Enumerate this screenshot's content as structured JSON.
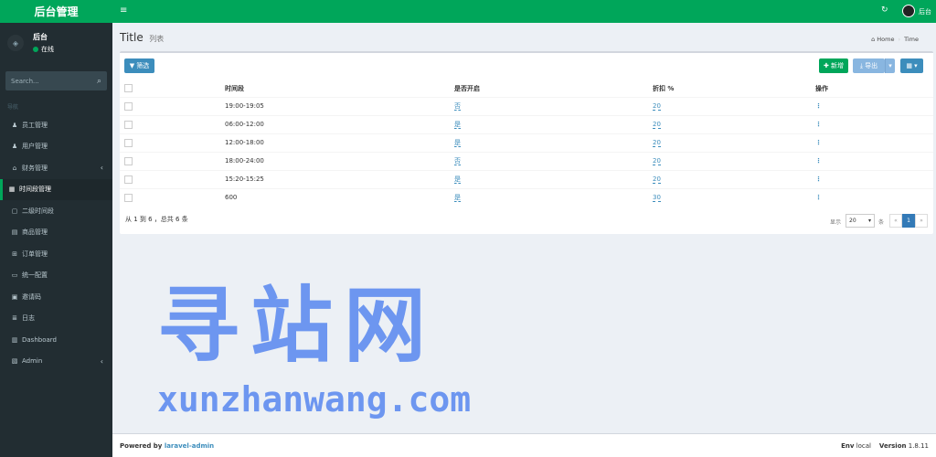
{
  "sidebar": {
    "logo": "后台管理",
    "user_name": "后台",
    "user_status": "在线",
    "search_placeholder": "Search...",
    "menu_header": "导航",
    "items": [
      {
        "label": "员工管理",
        "icon": "user-icon",
        "glyph": "♟",
        "arrow": ""
      },
      {
        "label": "用户管理",
        "icon": "user-icon",
        "glyph": "♟",
        "arrow": ""
      },
      {
        "label": "财务管理",
        "icon": "bank-icon",
        "glyph": "⌂",
        "arrow": "‹"
      },
      {
        "label": "时间段管理",
        "icon": "calendar-icon",
        "glyph": "▦",
        "arrow": ""
      },
      {
        "label": "二级时间段",
        "icon": "calendar-icon",
        "glyph": "▢",
        "arrow": ""
      },
      {
        "label": "商品管理",
        "icon": "product-icon",
        "glyph": "▤",
        "arrow": ""
      },
      {
        "label": "订单管理",
        "icon": "cart-icon",
        "glyph": "⊞",
        "arrow": ""
      },
      {
        "label": "统一配置",
        "icon": "monitor-icon",
        "glyph": "▭",
        "arrow": ""
      },
      {
        "label": "邀请码",
        "icon": "code-icon",
        "glyph": "▣",
        "arrow": ""
      },
      {
        "label": "日志",
        "icon": "list-icon",
        "glyph": "≣",
        "arrow": ""
      },
      {
        "label": "Dashboard",
        "icon": "dashboard-icon",
        "glyph": "▥",
        "arrow": ""
      },
      {
        "label": "Admin",
        "icon": "tasks-icon",
        "glyph": "▧",
        "arrow": "‹"
      }
    ]
  },
  "header": {
    "menu_glyph": "≡",
    "refresh_glyph": "↻",
    "user_name": "后台"
  },
  "page": {
    "title": "Title",
    "subtitle": "列表",
    "breadcrumb_home": "Home",
    "breadcrumb_current": "Time"
  },
  "toolbar": {
    "filter_label": "▼ 筛选",
    "new_label": "✚ 新增",
    "export_label": "⤓ 导出",
    "columns_label": "▦ ▾"
  },
  "table": {
    "columns": [
      "时间段",
      "是否开启",
      "折扣 %",
      "操作"
    ],
    "rows": [
      {
        "time": "19:00-19:05",
        "open": "否",
        "discount": "20"
      },
      {
        "time": "06:00-12:00",
        "open": "是",
        "discount": "20"
      },
      {
        "time": "12:00-18:00",
        "open": "是",
        "discount": "20"
      },
      {
        "time": "18:00-24:00",
        "open": "否",
        "discount": "20"
      },
      {
        "time": "15:20-15:25",
        "open": "是",
        "discount": "20"
      },
      {
        "time": "600",
        "open": "是",
        "discount": "30"
      }
    ],
    "action_glyph": "⋮"
  },
  "pagination": {
    "info": "从 1 到 6 ，总共 6 条",
    "show_label": "显示",
    "per_page": "20",
    "unit_label": "条",
    "prev": "«",
    "current": "1",
    "next": "»"
  },
  "watermark": {
    "cn": "寻站网",
    "en": "xunzhanwang.com"
  },
  "footer": {
    "powered_by": "Powered by",
    "link": "laravel-admin",
    "env_label": "Env",
    "env_value": "local",
    "version_label": "Version",
    "version_value": "1.8.11"
  }
}
